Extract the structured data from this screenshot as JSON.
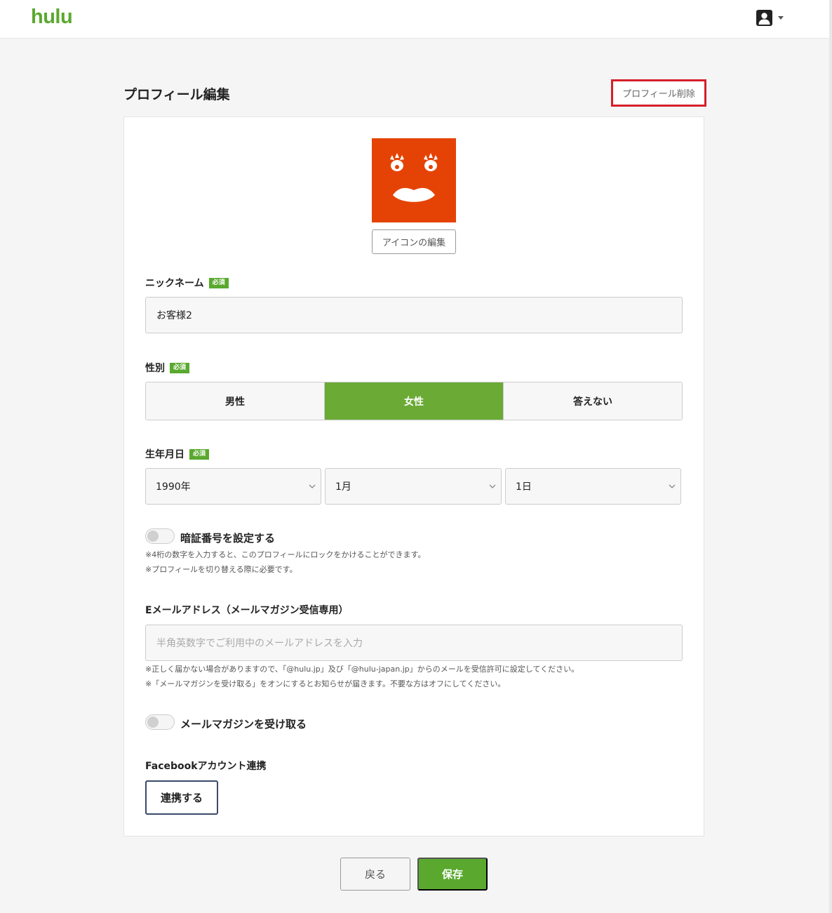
{
  "header": {
    "logo": "hulu",
    "account_icon": "user-avatar-icon",
    "dropdown_icon": "caret-down-icon"
  },
  "page": {
    "title": "プロフィール編集",
    "delete_label": "プロフィール削除"
  },
  "profile_icon": {
    "icon": "face-icon",
    "color": "#e54305",
    "edit_label": "アイコンの編集"
  },
  "nickname": {
    "label": "ニックネーム",
    "required": "必須",
    "value": "お客様2"
  },
  "gender": {
    "label": "性別",
    "required": "必須",
    "options": [
      "男性",
      "女性",
      "答えない"
    ],
    "selected": "女性"
  },
  "birthday": {
    "label": "生年月日",
    "required": "必須",
    "year": "1990年",
    "month": "1月",
    "day": "1日"
  },
  "pin": {
    "label": "暗証番号を設定する",
    "notes": [
      "※4桁の数字を入力すると、このプロフィールにロックをかけることができます。",
      "※プロフィールを切り替える際に必要です。"
    ]
  },
  "email": {
    "label": "Eメールアドレス（メールマガジン受信専用）",
    "placeholder": "半角英数字でご利用中のメールアドレスを入力",
    "notes": [
      "※正しく届かない場合がありますので、「@hulu.jp」及び「@hulu-japan.jp」からのメールを受信許可に設定してください。",
      "※「メールマガジンを受け取る」をオンにするとお知らせが届きます。不要な方はオフにしてください。"
    ]
  },
  "newsletter": {
    "label": "メールマガジンを受け取る"
  },
  "facebook": {
    "label": "Facebookアカウント連携",
    "button": "連携する"
  },
  "footer": {
    "back_label": "戻る",
    "save_label": "保存"
  },
  "colors": {
    "brand": "#5aa92e",
    "selected": "#6aaa35",
    "danger": "#d5202a"
  }
}
